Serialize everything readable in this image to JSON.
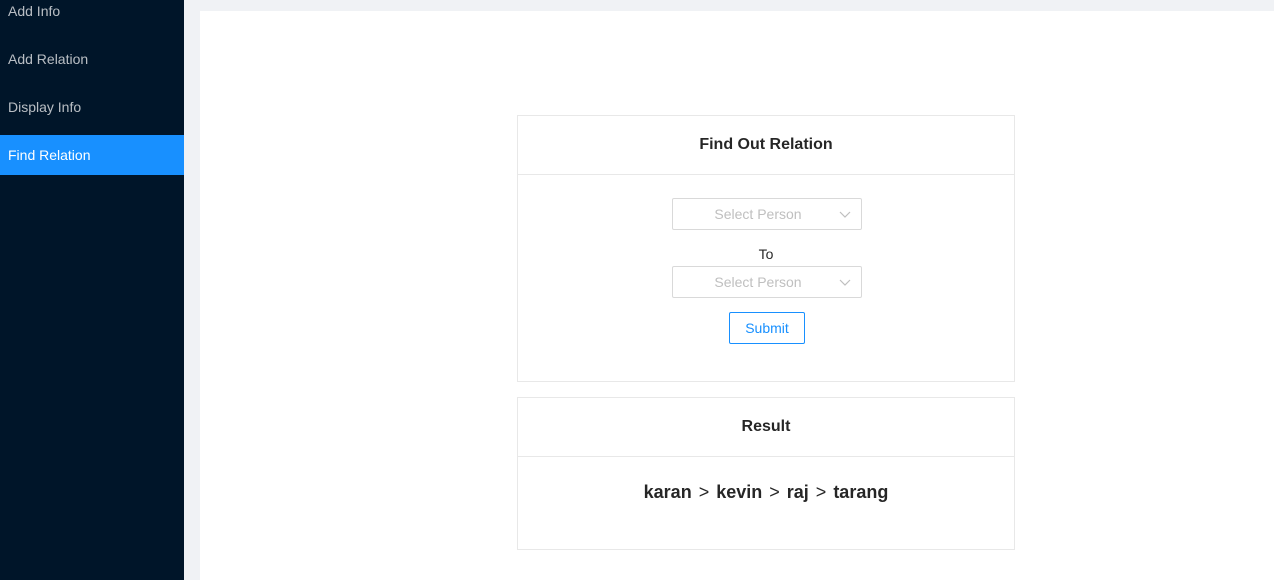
{
  "sidebar": {
    "items": [
      {
        "label": "Add Info",
        "selected": false
      },
      {
        "label": "Add Relation",
        "selected": false
      },
      {
        "label": "Display Info",
        "selected": false
      },
      {
        "label": "Find Relation",
        "selected": true
      }
    ]
  },
  "find_card": {
    "title": "Find Out Relation",
    "from_select": {
      "placeholder": "Select Person"
    },
    "to_label": "To",
    "to_select": {
      "placeholder": "Select Person"
    },
    "submit_label": "Submit"
  },
  "result_card": {
    "title": "Result",
    "path": [
      "karan",
      "kevin",
      "raj",
      "tarang"
    ],
    "separator": ">"
  },
  "colors": {
    "sidebar_bg": "#001529",
    "accent": "#1890ff",
    "page_bg": "#f0f2f5"
  }
}
